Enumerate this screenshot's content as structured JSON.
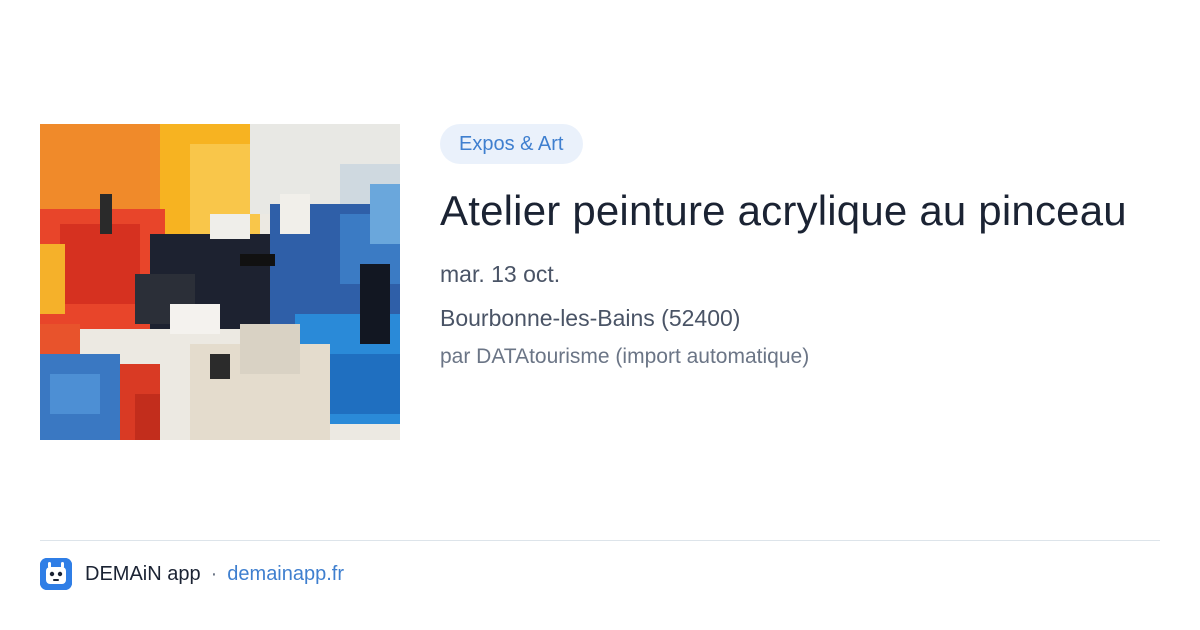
{
  "event": {
    "category": "Expos & Art",
    "title": "Atelier peinture acrylique au pinceau",
    "date": "mar. 13 oct.",
    "location": "Bourbonne-les-Bains (52400)",
    "source": "par DATAtourisme (import automatique)",
    "image_icon": "abstract-painting-thumbnail"
  },
  "footer": {
    "app_name": "DEMAiN app",
    "separator": "·",
    "site_link": "demainapp.fr",
    "logo_icon": "demain-app-logo-icon"
  },
  "colors": {
    "accent": "#3f7fcf",
    "pill_background": "#eaf1fb",
    "title_text": "#1b2333",
    "body_text": "#4a5466",
    "muted_text": "#6b7586",
    "divider": "#dde4ea",
    "logo_background": "#2f7ee6"
  }
}
